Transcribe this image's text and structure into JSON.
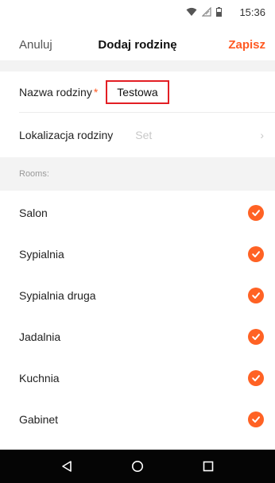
{
  "status_bar": {
    "time": "15:36",
    "icons": [
      "wifi-icon",
      "signal-icon",
      "battery-icon"
    ]
  },
  "header": {
    "cancel_label": "Anuluj",
    "title": "Dodaj rodzinę",
    "save_label": "Zapisz"
  },
  "form": {
    "name_label": "Nazwa rodziny",
    "required_mark": "*",
    "name_value": "Testowa",
    "location_label": "Lokalizacja rodziny",
    "location_value": "Set",
    "chevron": "›"
  },
  "rooms": {
    "header": "Rooms:",
    "items": [
      {
        "label": "Salon",
        "checked": true
      },
      {
        "label": "Sypialnia",
        "checked": true
      },
      {
        "label": "Sypialnia druga",
        "checked": true
      },
      {
        "label": "Jadalnia",
        "checked": true
      },
      {
        "label": "Kuchnia",
        "checked": true
      },
      {
        "label": "Gabinet",
        "checked": true
      }
    ]
  },
  "colors": {
    "accent": "#ff5a23",
    "highlight_border": "#e31e24",
    "check": "#ff6224"
  },
  "system_nav": {
    "icons": [
      "back-icon",
      "home-icon",
      "recents-icon"
    ]
  }
}
